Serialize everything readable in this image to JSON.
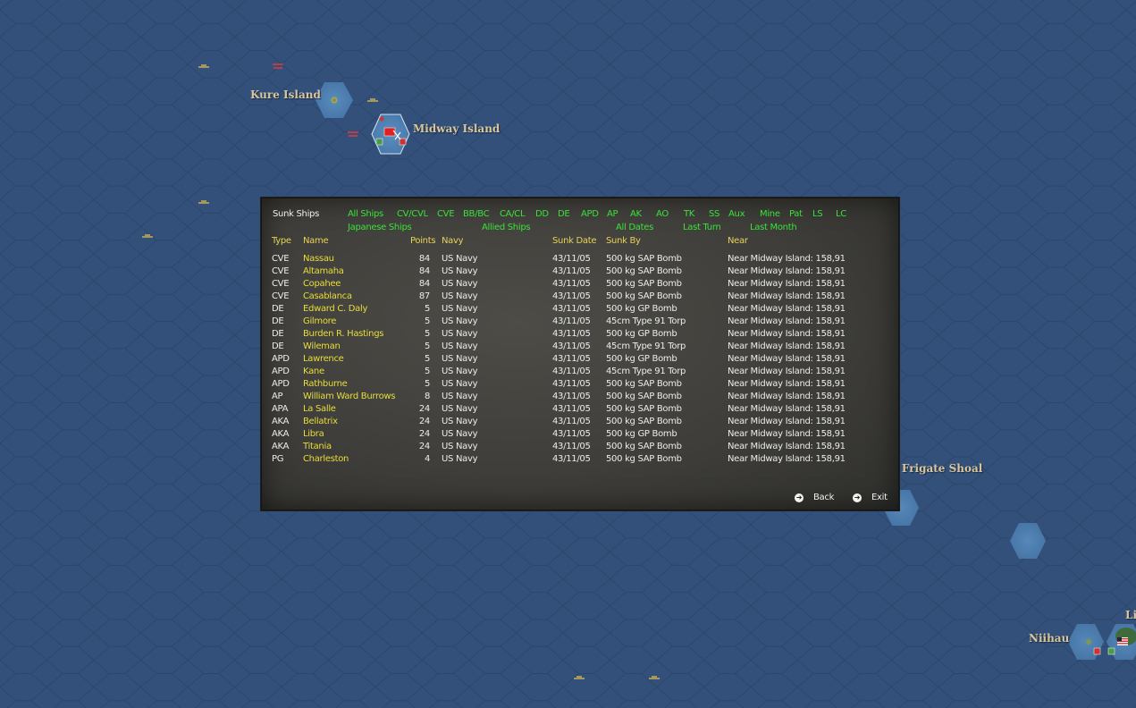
{
  "map": {
    "labels": {
      "kure": "Kure Island",
      "midway": "Midway Island",
      "frigate": "n Frigate Shoal",
      "niihau": "Niihau",
      "li": "Li"
    }
  },
  "panel": {
    "title": "Sunk Ships",
    "filters_row1": [
      "All Ships",
      "CV/CVL",
      "CVE",
      "BB/BC",
      "CA/CL",
      "DD",
      "DE",
      "APD",
      "AP",
      "AK",
      "AO",
      "TK",
      "SS",
      "Aux",
      "Mine",
      "Pat",
      "LS",
      "LC"
    ],
    "filters_row2": [
      "Japanese Ships",
      "Allied Ships",
      "All Dates",
      "Last Turn",
      "Last Month"
    ],
    "columns": [
      "Type",
      "Name",
      "Points",
      "Navy",
      "Sunk Date",
      "Sunk By",
      "Near"
    ],
    "rows": [
      {
        "type": "CVE",
        "name": "Nassau",
        "points": "84",
        "navy": "US Navy",
        "date": "43/11/05",
        "by": "500 kg SAP Bomb",
        "near": "Near Midway Island: 158,91"
      },
      {
        "type": "CVE",
        "name": "Altamaha",
        "points": "84",
        "navy": "US Navy",
        "date": "43/11/05",
        "by": "500 kg SAP Bomb",
        "near": "Near Midway Island: 158,91"
      },
      {
        "type": "CVE",
        "name": "Copahee",
        "points": "84",
        "navy": "US Navy",
        "date": "43/11/05",
        "by": "500 kg SAP Bomb",
        "near": "Near Midway Island: 158,91"
      },
      {
        "type": "CVE",
        "name": "Casablanca",
        "points": "87",
        "navy": "US Navy",
        "date": "43/11/05",
        "by": "500 kg SAP Bomb",
        "near": "Near Midway Island: 158,91"
      },
      {
        "type": "DE",
        "name": "Edward C. Daly",
        "points": "5",
        "navy": "US Navy",
        "date": "43/11/05",
        "by": "500 kg GP Bomb",
        "near": "Near Midway Island: 158,91"
      },
      {
        "type": "DE",
        "name": "Gilmore",
        "points": "5",
        "navy": "US Navy",
        "date": "43/11/05",
        "by": "45cm Type 91 Torp",
        "near": "Near Midway Island: 158,91"
      },
      {
        "type": "DE",
        "name": "Burden R. Hastings",
        "points": "5",
        "navy": "US Navy",
        "date": "43/11/05",
        "by": "500 kg GP Bomb",
        "near": "Near Midway Island: 158,91"
      },
      {
        "type": "DE",
        "name": "Wileman",
        "points": "5",
        "navy": "US Navy",
        "date": "43/11/05",
        "by": "45cm Type 91 Torp",
        "near": "Near Midway Island: 158,91"
      },
      {
        "type": "APD",
        "name": "Lawrence",
        "points": "5",
        "navy": "US Navy",
        "date": "43/11/05",
        "by": "500 kg GP Bomb",
        "near": "Near Midway Island: 158,91"
      },
      {
        "type": "APD",
        "name": "Kane",
        "points": "5",
        "navy": "US Navy",
        "date": "43/11/05",
        "by": "45cm Type 91 Torp",
        "near": "Near Midway Island: 158,91"
      },
      {
        "type": "APD",
        "name": "Rathburne",
        "points": "5",
        "navy": "US Navy",
        "date": "43/11/05",
        "by": "500 kg SAP Bomb",
        "near": "Near Midway Island: 158,91"
      },
      {
        "type": "AP",
        "name": "William Ward Burrows",
        "points": "8",
        "navy": "US Navy",
        "date": "43/11/05",
        "by": "500 kg SAP Bomb",
        "near": "Near Midway Island: 158,91"
      },
      {
        "type": "APA",
        "name": "La Salle",
        "points": "24",
        "navy": "US Navy",
        "date": "43/11/05",
        "by": "500 kg SAP Bomb",
        "near": "Near Midway Island: 158,91"
      },
      {
        "type": "AKA",
        "name": "Bellatrix",
        "points": "24",
        "navy": "US Navy",
        "date": "43/11/05",
        "by": "500 kg SAP Bomb",
        "near": "Near Midway Island: 158,91"
      },
      {
        "type": "AKA",
        "name": "Libra",
        "points": "24",
        "navy": "US Navy",
        "date": "43/11/05",
        "by": "500 kg GP Bomb",
        "near": "Near Midway Island: 158,91"
      },
      {
        "type": "AKA",
        "name": "Titania",
        "points": "24",
        "navy": "US Navy",
        "date": "43/11/05",
        "by": "500 kg SAP Bomb",
        "near": "Near Midway Island: 158,91"
      },
      {
        "type": "PG",
        "name": "Charleston",
        "points": "4",
        "navy": "US Navy",
        "date": "43/11/05",
        "by": "500 kg SAP Bomb",
        "near": "Near Midway Island: 158,91"
      }
    ],
    "back_label": "Back",
    "exit_label": "Exit"
  },
  "colors": {
    "ocean": "#33507a",
    "filter_green": "#39e239",
    "header_yellow": "#e6d35a",
    "ship_yellow": "#e6dd3c"
  }
}
